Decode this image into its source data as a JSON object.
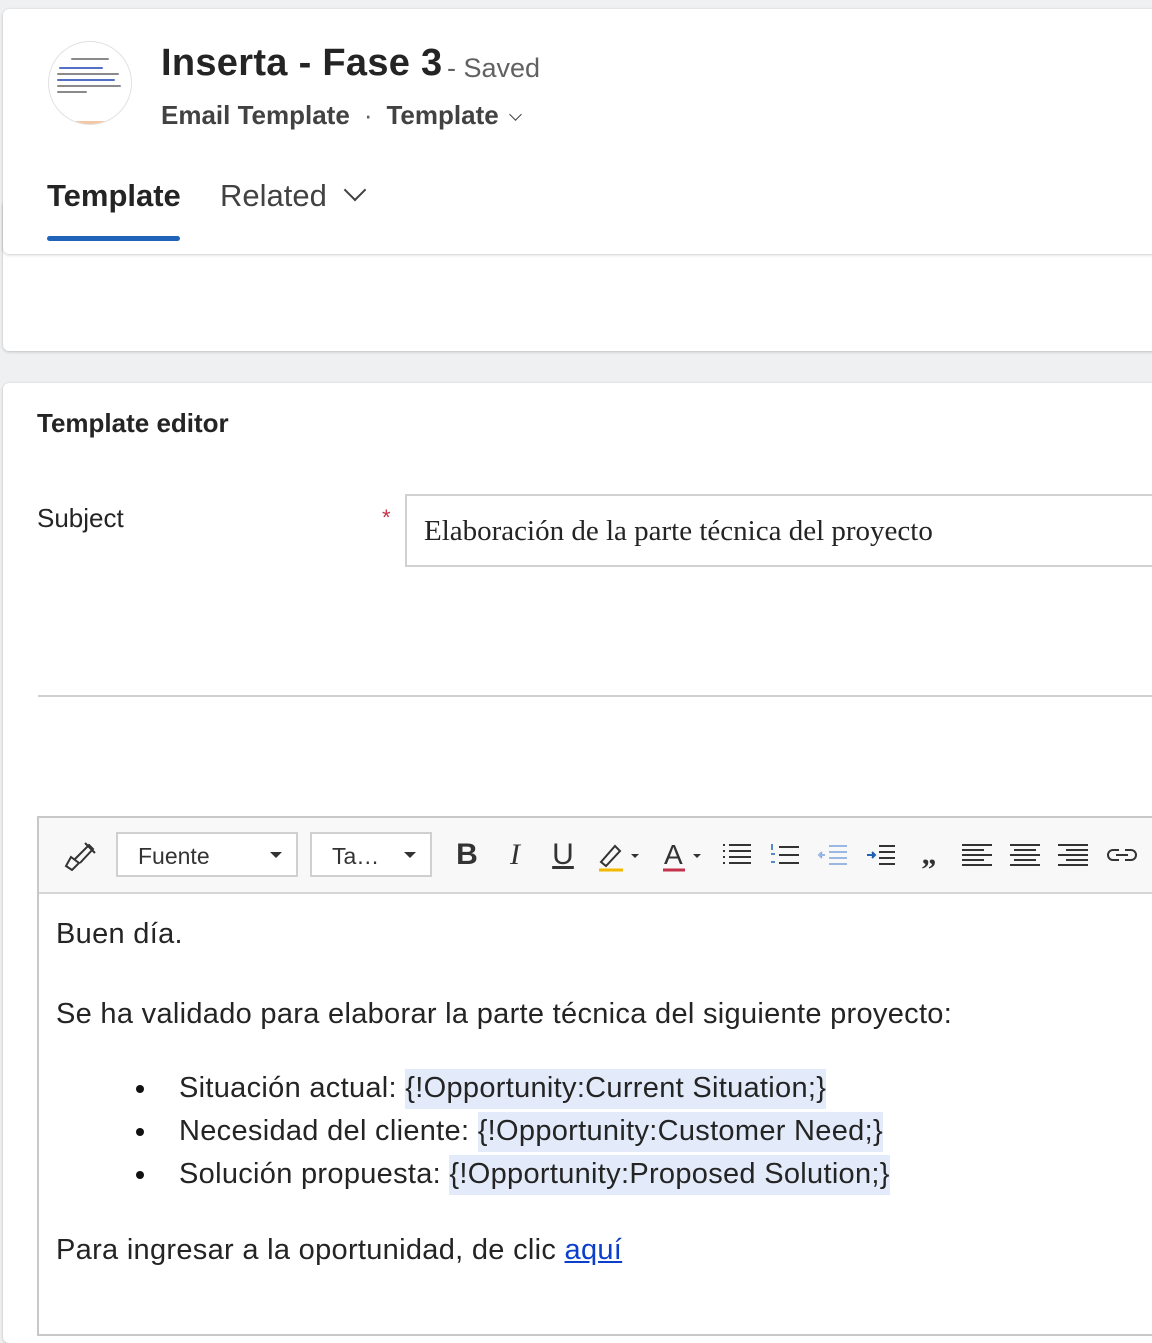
{
  "header": {
    "title": "Inserta - Fase 3",
    "saved_status": "- Saved",
    "entity": "Email Template",
    "separator": "·",
    "form_selector": "Template",
    "avatar": "template-thumbnail-image"
  },
  "tabs": [
    {
      "label": "Template",
      "selected": true
    },
    {
      "label": "Related",
      "selected": false
    }
  ],
  "colors": {
    "accent": "#1f64b9",
    "required": "#c4314b",
    "link": "#0b3ecb",
    "placeholder_highlight": "#e3ebfa"
  },
  "editor_section": {
    "title": "Template editor",
    "subject_label": "Subject",
    "required_marker": "*",
    "subject_value": "Elaboración de la parte técnica del proyecto"
  },
  "toolbar": {
    "font_dropdown": "Fuente",
    "size_dropdown": "Ta…",
    "icons": [
      "format-painter-icon",
      "bold-icon",
      "italic-icon",
      "underline-icon",
      "highlight-icon",
      "font-color-icon",
      "bulleted-list-icon",
      "numbered-list-icon",
      "decrease-indent-icon",
      "increase-indent-icon",
      "quote-icon",
      "align-left-icon",
      "align-center-icon",
      "align-right-icon",
      "link-icon"
    ],
    "bold_glyph": "B",
    "italic_glyph": "I",
    "underline_glyph": "U",
    "font_color_glyph": "A",
    "quote_glyph": "„"
  },
  "body": {
    "greeting": "Buen día.",
    "intro": "Se ha validado para elaborar la parte técnica del siguiente proyecto:",
    "items": [
      {
        "label": "Situación actual: ",
        "token": "{!Opportunity:Current Situation;}"
      },
      {
        "label": "Necesidad del cliente: ",
        "token": "{!Opportunity:Customer Need;}"
      },
      {
        "label": "Solución propuesta: ",
        "token": "{!Opportunity:Proposed Solution;}"
      }
    ],
    "closing_text": "Para ingresar a la oportunidad, de clic ",
    "closing_link": "aquí"
  }
}
